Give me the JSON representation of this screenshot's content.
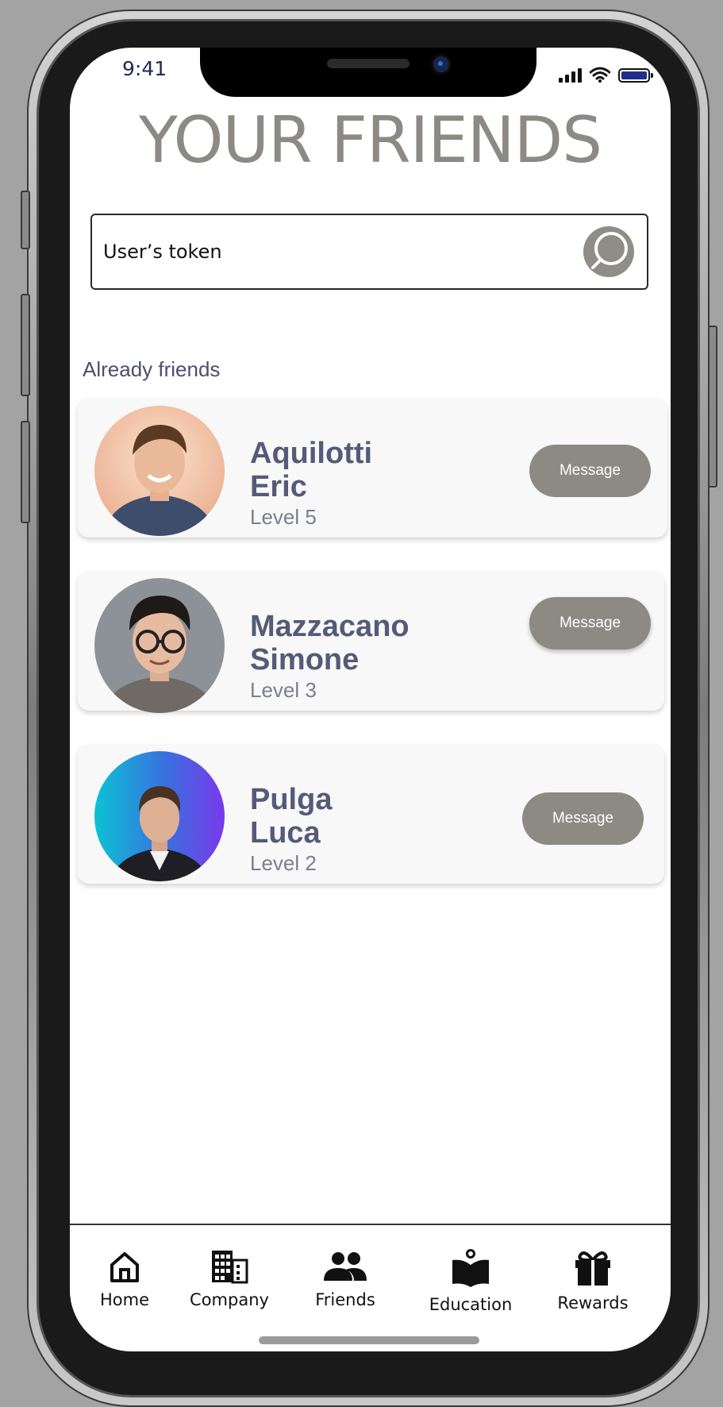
{
  "status_bar": {
    "time": "9:41"
  },
  "page": {
    "title": "YOUR FRIENDS"
  },
  "search": {
    "value": "User’s token",
    "icon": "search-icon"
  },
  "section": {
    "label": "Already friends"
  },
  "friends": [
    {
      "surname": "Aquilotti",
      "first_name": "Eric",
      "level": "Level 5",
      "button": "Message"
    },
    {
      "surname": "Mazzacano",
      "first_name": "Simone",
      "level": "Level 3",
      "button": "Message"
    },
    {
      "surname": "Pulga",
      "first_name": "Luca",
      "level": "Level 2",
      "button": "Message"
    }
  ],
  "nav": {
    "items": [
      {
        "label": "Home",
        "icon": "home-icon"
      },
      {
        "label": "Company",
        "icon": "building-icon"
      },
      {
        "label": "Friends",
        "icon": "people-icon"
      },
      {
        "label": "Education",
        "icon": "book-icon"
      },
      {
        "label": "Rewards",
        "icon": "gift-icon"
      }
    ]
  },
  "colors": {
    "title": "#8d8a85",
    "button": "#8d8983",
    "name": "#555a78"
  }
}
